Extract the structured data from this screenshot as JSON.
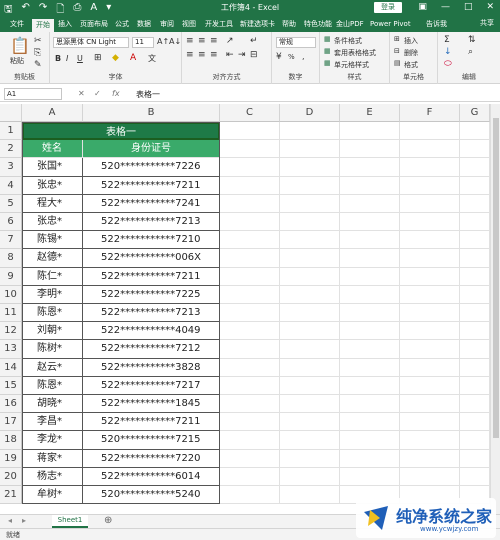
{
  "colors": {
    "excel_green": "#217346",
    "header_dark": "#1e7a47",
    "header_light": "#3aaa6a"
  },
  "window": {
    "title": "工作簿4 - Excel",
    "login": "登录"
  },
  "qat": [
    "save-icon",
    "undo-icon",
    "redo-icon"
  ],
  "tabs": [
    "文件",
    "开始",
    "插入",
    "页面布局",
    "公式",
    "数据",
    "审阅",
    "视图",
    "开发工具",
    "新建选项卡",
    "帮助",
    "特色功能",
    "金山PDF",
    "Power Pivot",
    "告诉我",
    "共享"
  ],
  "ribbon": {
    "clipboard": {
      "paste": "粘贴",
      "label": "剪贴板"
    },
    "font": {
      "name": "思源黑体 CN Light",
      "size": "11",
      "label": "字体",
      "bold": "B",
      "italic": "I",
      "underline": "U"
    },
    "alignment": {
      "label": "对齐方式"
    },
    "number": {
      "format": "常规",
      "percent": "%",
      "label": "数字"
    },
    "styles": {
      "conditional": "条件格式",
      "table": "套用表格格式",
      "cell": "单元格样式",
      "label": "样式"
    },
    "cells": {
      "insert": "插入",
      "delete": "删除",
      "format": "格式",
      "label": "单元格"
    },
    "editing": {
      "label": "编辑"
    }
  },
  "formula": {
    "namebox": "A1",
    "fx": "fx",
    "value": "表格一"
  },
  "columns": [
    "A",
    "B",
    "C",
    "D",
    "E",
    "F",
    "G"
  ],
  "rows": [
    "1",
    "2",
    "3",
    "4",
    "5",
    "6",
    "7",
    "8",
    "9",
    "10",
    "11",
    "12",
    "13",
    "14",
    "15",
    "16",
    "17",
    "18",
    "19",
    "20",
    "21"
  ],
  "table": {
    "title": "表格一",
    "headers": [
      "姓名",
      "身份证号"
    ],
    "names": [
      "张国*",
      "张忠*",
      "程大*",
      "张忠*",
      "陈锡*",
      "赵德*",
      "陈仁*",
      "李明*",
      "陈恩*",
      "刘朝*",
      "陈树*",
      "赵云*",
      "陈恩*",
      "胡晓*",
      "李昌*",
      "李龙*",
      "蒋家*",
      "杨志*",
      "牟树*"
    ],
    "ids": [
      "520***********7226",
      "522***********7211",
      "522***********7241",
      "522***********7213",
      "522***********7210",
      "522***********006X",
      "522***********7211",
      "522***********7225",
      "522***********7213",
      "522***********4049",
      "522***********7212",
      "522***********3828",
      "522***********7217",
      "522***********1845",
      "522***********7211",
      "520***********7215",
      "522***********7220",
      "522***********6014",
      "520***********5240"
    ]
  },
  "sheet_tab": "Sheet1",
  "status": "就绪",
  "watermark": {
    "text": "纯净系统之家",
    "url": "www.ycwjzy.com"
  }
}
